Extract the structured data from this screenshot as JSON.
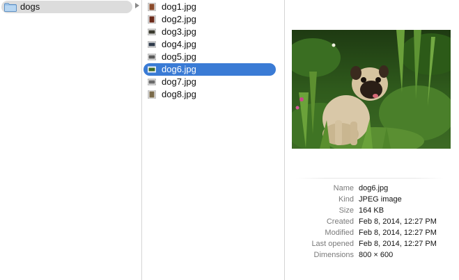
{
  "column1": {
    "folder": {
      "label": "dogs",
      "icon": "folder-icon"
    },
    "disclosure_icon": "disclosure-triangle-icon"
  },
  "column2": {
    "files": [
      {
        "label": "dog1.jpg",
        "thumb_color": "#8a4a2a"
      },
      {
        "label": "dog2.jpg",
        "thumb_color": "#6b2a1a"
      },
      {
        "label": "dog3.jpg",
        "thumb_color": "#3a3a2e"
      },
      {
        "label": "dog4.jpg",
        "thumb_color": "#2e3a4a"
      },
      {
        "label": "dog5.jpg",
        "thumb_color": "#5a5a5a"
      },
      {
        "label": "dog6.jpg",
        "thumb_color": "#3e6b2a",
        "selected": true
      },
      {
        "label": "dog7.jpg",
        "thumb_color": "#6a6a6a"
      },
      {
        "label": "dog8.jpg",
        "thumb_color": "#7a6a4a"
      }
    ],
    "selected_color": "#3a7bd5"
  },
  "preview": {
    "image": "pug-in-garden-photo",
    "info": [
      {
        "key": "Name",
        "value": "dog6.jpg"
      },
      {
        "key": "Kind",
        "value": "JPEG image"
      },
      {
        "key": "Size",
        "value": "164 KB"
      },
      {
        "key": "Created",
        "value": "Feb 8, 2014, 12:27 PM"
      },
      {
        "key": "Modified",
        "value": "Feb 8, 2014, 12:27 PM"
      },
      {
        "key": "Last opened",
        "value": "Feb 8, 2014, 12:27 PM"
      },
      {
        "key": "Dimensions",
        "value": "800 × 600"
      }
    ]
  }
}
